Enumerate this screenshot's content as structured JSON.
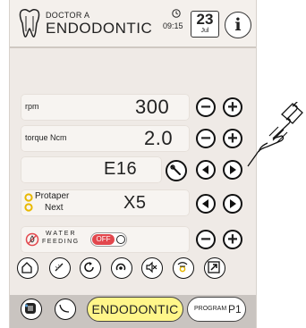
{
  "header": {
    "brand_top": "DOCTOR A",
    "brand_bottom": "ENDODONTIC",
    "time": "09:15",
    "calendar_day": "23",
    "calendar_month": "Jul",
    "info_label": "i"
  },
  "speed": {
    "label": "rpm",
    "value": "300",
    "minus": "−",
    "plus": "+"
  },
  "torque": {
    "label": "torque Ncm",
    "value": "2.0",
    "minus": "−",
    "plus": "+"
  },
  "error": {
    "code": "E16"
  },
  "file": {
    "line1": "Protaper",
    "line2": "Next",
    "size": "X5"
  },
  "water": {
    "label_top": "WATER",
    "label_bottom": "FEEDING",
    "toggle": "OFF",
    "minus": "−",
    "plus": "+"
  },
  "bottom": {
    "mode": "ENDODONTIC",
    "program_label": "PROGRAM",
    "program_value": "P1"
  },
  "colors": {
    "toggle_off": "#e2474d",
    "mode_bg": "#fff68a",
    "file_ring": "#e8b800",
    "bottom_bar": "#c9c4c0"
  }
}
